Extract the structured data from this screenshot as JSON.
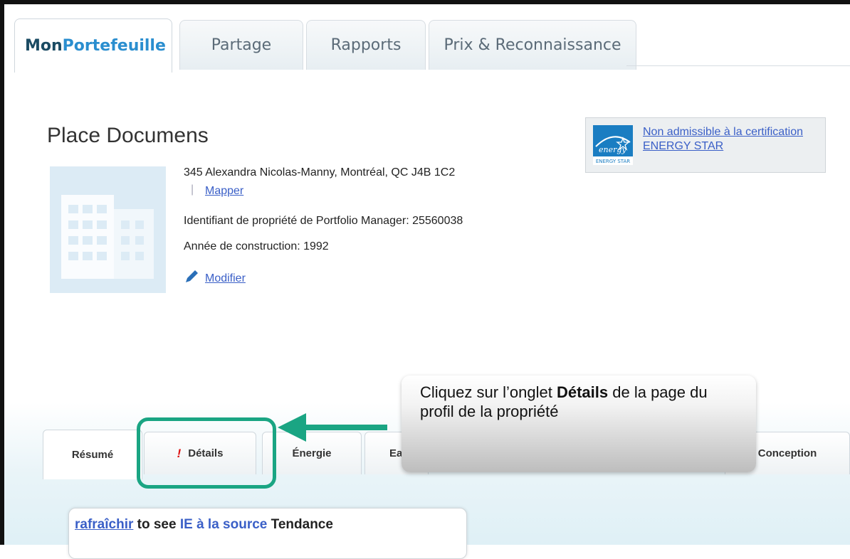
{
  "top_tabs": {
    "myportfolio_a": "Mon",
    "myportfolio_b": "Portefeuille",
    "sharing": "Partage",
    "reports": "Rapports",
    "awards": "Prix & Reconnaissance"
  },
  "property": {
    "name": "Place Documens",
    "address": "345 Alexandra Nicolas-Manny, Montréal, QC J4B 1C2",
    "separator": "|",
    "map_link": "Mapper",
    "pm_id": "Identifiant de propriété de Portfolio Manager: 25560038",
    "year_built": "Année de construction: 1992",
    "edit_link": "Modifier"
  },
  "energy_star": {
    "logo_script": "energy",
    "logo_caption": "ENERGY STAR",
    "status_link": "Non admissible à la certification ENERGY STAR"
  },
  "profile_tabs": {
    "summary": "Résumé",
    "details_alert": "!",
    "details": "Détails",
    "energy": "Énergie",
    "water_partial": "Ea",
    "design": "Conception"
  },
  "callout": {
    "before": "Cliquez sur l’onglet ",
    "bold": "Détails",
    "after": " de la page du profil de la propriété"
  },
  "trend_card": {
    "refresh_link": "rafraîchir",
    "to_see": " to see ",
    "metric": "IE à la source",
    "trend": " Tendance"
  },
  "colors": {
    "highlight": "#1aa583",
    "link": "#3a5fc7",
    "brand_dark": "#1b4b63",
    "brand_light": "#2a8ecf"
  }
}
